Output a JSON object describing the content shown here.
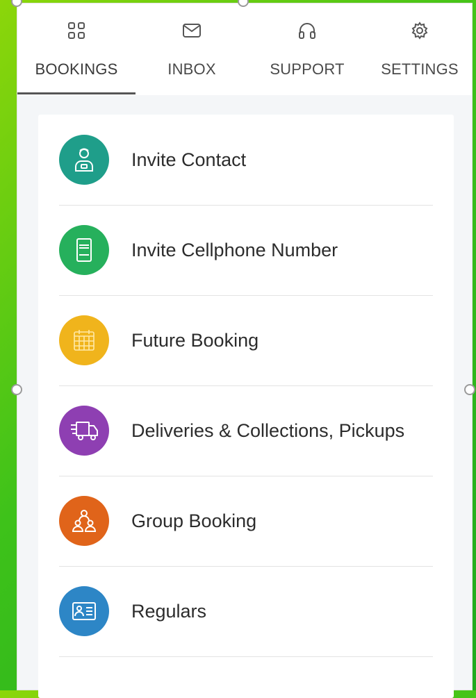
{
  "tabs": [
    {
      "label": "BOOKINGS",
      "icon": "grid-icon",
      "active": true
    },
    {
      "label": "INBOX",
      "icon": "envelope-icon",
      "active": false
    },
    {
      "label": "SUPPORT",
      "icon": "headset-icon",
      "active": false
    },
    {
      "label": "SETTINGS",
      "icon": "gear-icon",
      "active": false
    }
  ],
  "menu": [
    {
      "label": "Invite Contact",
      "icon": "contact-person-icon",
      "color": "#1f9e8a"
    },
    {
      "label": "Invite Cellphone Number",
      "icon": "cellphone-icon",
      "color": "#26b05c"
    },
    {
      "label": "Future Booking",
      "icon": "calendar-icon",
      "color": "#f0b41c"
    },
    {
      "label": "Deliveries & Collections, Pickups",
      "icon": "delivery-truck-icon",
      "color": "#8e3fb2"
    },
    {
      "label": "Group Booking",
      "icon": "group-icon",
      "color": "#e0641a"
    },
    {
      "label": "Regulars",
      "icon": "id-card-icon",
      "color": "#2d86c6"
    }
  ],
  "colors": {
    "tab_text": "#4a4a4a",
    "active_indicator": "#555555",
    "content_bg": "#f4f6f8"
  }
}
